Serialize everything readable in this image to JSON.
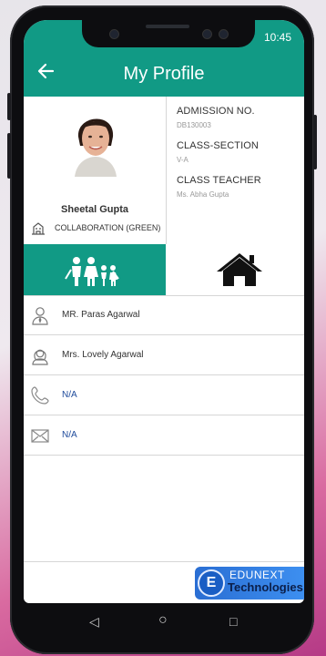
{
  "status": {
    "time": "10:45"
  },
  "appbar": {
    "title": "My Profile",
    "back_icon": "arrow-left-icon"
  },
  "profile": {
    "name": "Sheetal Gupta",
    "house": "COLLABORATION (GREEN)",
    "admission_label": "ADMISSION NO.",
    "admission_value": "DB130003",
    "class_label": "CLASS-SECTION",
    "class_value": "V-A",
    "teacher_label": "CLASS TEACHER",
    "teacher_value": "Ms. Abha Gupta"
  },
  "tabs": [
    {
      "icon": "family-icon",
      "active": true
    },
    {
      "icon": "home-icon",
      "active": false
    }
  ],
  "contacts": [
    {
      "icon": "father-icon",
      "text": "MR. Paras  Agarwal"
    },
    {
      "icon": "mother-icon",
      "text": "Mrs. Lovely  Agarwal"
    },
    {
      "icon": "phone-icon",
      "text": "N/A"
    },
    {
      "icon": "mail-icon",
      "text": "N/A"
    }
  ],
  "brand": {
    "line1": "EDUNEXT",
    "line2": "Technologies",
    "logo_letter": "E"
  },
  "navigation": {
    "back": "◁",
    "home": "○",
    "recents": "□"
  },
  "colors": {
    "primary": "#119a85",
    "link": "#1e4a9b"
  }
}
